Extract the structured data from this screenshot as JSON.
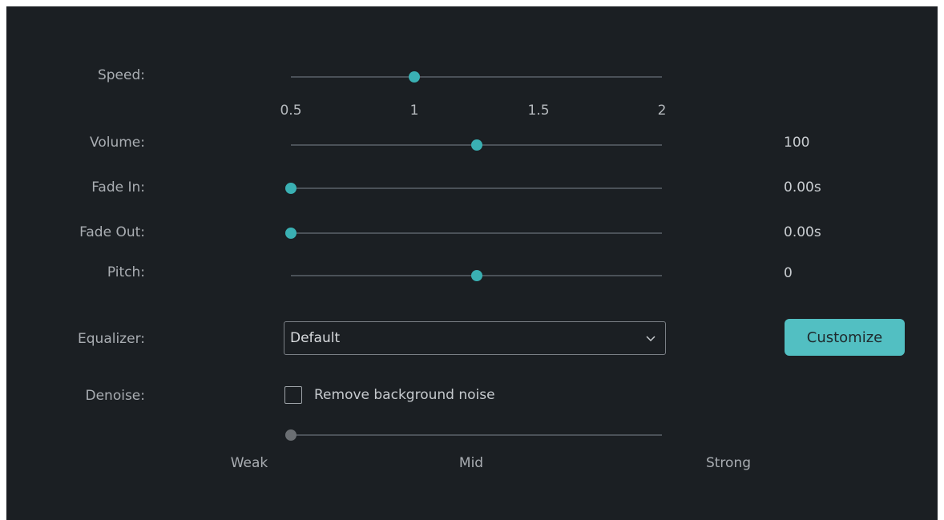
{
  "speed": {
    "label": "Speed:",
    "value": 1,
    "min": 0.5,
    "max": 2,
    "ticks": [
      "0.5",
      "1",
      "1.5",
      "2"
    ]
  },
  "volume": {
    "label": "Volume:",
    "value_text": "100",
    "fraction": 0.5
  },
  "fade_in": {
    "label": "Fade In:",
    "value_text": "0.00s",
    "fraction": 0
  },
  "fade_out": {
    "label": "Fade Out:",
    "value_text": "0.00s",
    "fraction": 0
  },
  "pitch": {
    "label": "Pitch:",
    "value_text": "0",
    "fraction": 0.5
  },
  "equalizer": {
    "label": "Equalizer:",
    "selected": "Default",
    "customize_label": "Customize"
  },
  "denoise": {
    "label": "Denoise:",
    "checkbox_label": "Remove background noise",
    "checked": false,
    "strength_fraction": 0,
    "strength_labels": [
      "Weak",
      "Mid",
      "Strong"
    ]
  },
  "colors": {
    "background": "#1b1f23",
    "accent": "#3ab0b3",
    "button": "#52bfc2",
    "track": "#4b5158"
  }
}
